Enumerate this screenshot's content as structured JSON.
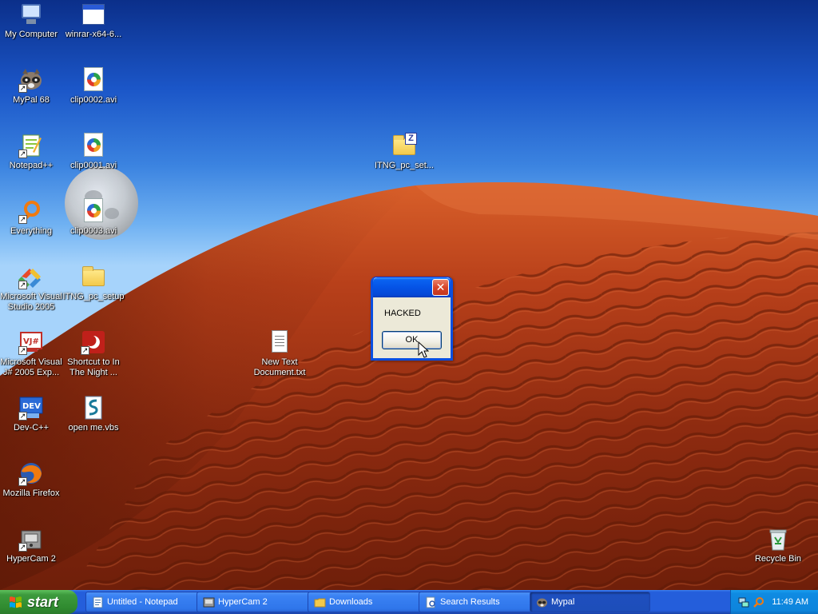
{
  "desktop": {
    "icons": [
      {
        "label": "My Computer",
        "icon": "my-computer-icon"
      },
      {
        "label": "winrar-x64-6...",
        "icon": "application-window-icon"
      },
      {
        "label": "MyPal 68",
        "icon": "mypal-raccoon-icon"
      },
      {
        "label": "clip0002.avi",
        "icon": "media-player-file-icon"
      },
      {
        "label": "Notepad++",
        "icon": "notepadpp-icon"
      },
      {
        "label": "clip0001.avi",
        "icon": "media-player-file-icon"
      },
      {
        "label": "ITNG_pc_set...",
        "icon": "zipped-folder-icon"
      },
      {
        "label": "Everything",
        "icon": "everything-search-icon"
      },
      {
        "label": "clip0003.avi",
        "icon": "media-player-file-icon"
      },
      {
        "label": "Microsoft Visual Studio 2005",
        "icon": "visual-studio-icon"
      },
      {
        "label": "ITNG_pc_setup",
        "icon": "folder-icon"
      },
      {
        "label": "Microsoft Visual J# 2005 Exp...",
        "icon": "visual-jsharp-icon"
      },
      {
        "label": "Shortcut to In The Night ...",
        "icon": "audio-shortcut-icon"
      },
      {
        "label": "New Text Document.txt",
        "icon": "text-document-icon"
      },
      {
        "label": "Dev-C++",
        "icon": "devcpp-icon"
      },
      {
        "label": "open me.vbs",
        "icon": "vbs-script-icon"
      },
      {
        "label": "Mozilla Firefox",
        "icon": "firefox-icon"
      },
      {
        "label": "HyperCam 2",
        "icon": "hypercam-icon"
      },
      {
        "label": "Recycle Bin",
        "icon": "recycle-bin-icon"
      }
    ]
  },
  "dialog": {
    "title": "",
    "message": "HACKED",
    "ok_label": "OK",
    "close_glyph": "✕"
  },
  "taskbar": {
    "start_label": "start",
    "buttons": [
      {
        "label": "Untitled - Notepad",
        "icon": "notepad-icon"
      },
      {
        "label": "HyperCam 2",
        "icon": "hypercam-icon"
      },
      {
        "label": "Downloads",
        "icon": "folder-icon"
      },
      {
        "label": "Search Results",
        "icon": "search-results-icon"
      },
      {
        "label": "Mypal",
        "icon": "mypal-raccoon-icon"
      }
    ],
    "active_index": 4,
    "clock": "11:49 AM"
  },
  "colors": {
    "taskbar_blue": "#245edb",
    "start_green": "#3d9a3d",
    "title_blue": "#0553e6",
    "dialog_face": "#ece9d8",
    "dune_red": "#b8401a"
  }
}
